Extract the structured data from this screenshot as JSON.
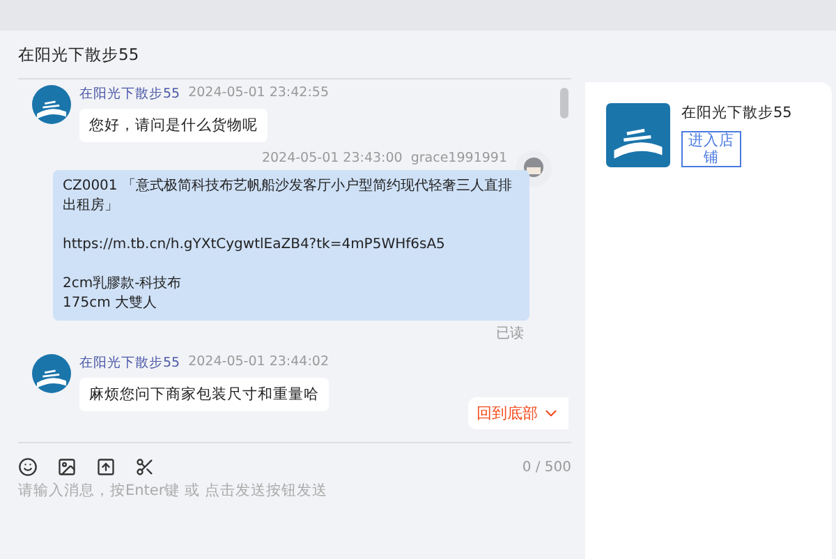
{
  "chat": {
    "title": "在阳光下散步55",
    "messages": [
      {
        "kind": "received",
        "sender": "在阳光下散步55",
        "time": "2024-05-01 23:42:55",
        "text": "您好，请问是什么货物呢"
      },
      {
        "kind": "sent",
        "sender": "grace1991991",
        "time": "2024-05-01 23:43:00",
        "text": "CZ0001 「意式极简科技布艺帆船沙发客厅小户型简约现代轻奢三人直排出租房」\n\nhttps://m.tb.cn/h.gYXtCygwtlEaZB4?tk=4mP5WHf6sA5\n\n2cm乳膠款-科技布\n175cm 大雙人",
        "status": "已读"
      },
      {
        "kind": "received",
        "sender": "在阳光下散步55",
        "time": "2024-05-01 23:44:02",
        "text": "麻烦您问下商家包装尺寸和重量哈"
      }
    ],
    "scroll_button": "回到底部",
    "input": {
      "placeholder": "请输入消息，按Enter键 或 点击发送按钮发送",
      "counter": "0 / 500"
    }
  },
  "shop": {
    "name": "在阳光下散步55",
    "button": "进入店铺"
  }
}
